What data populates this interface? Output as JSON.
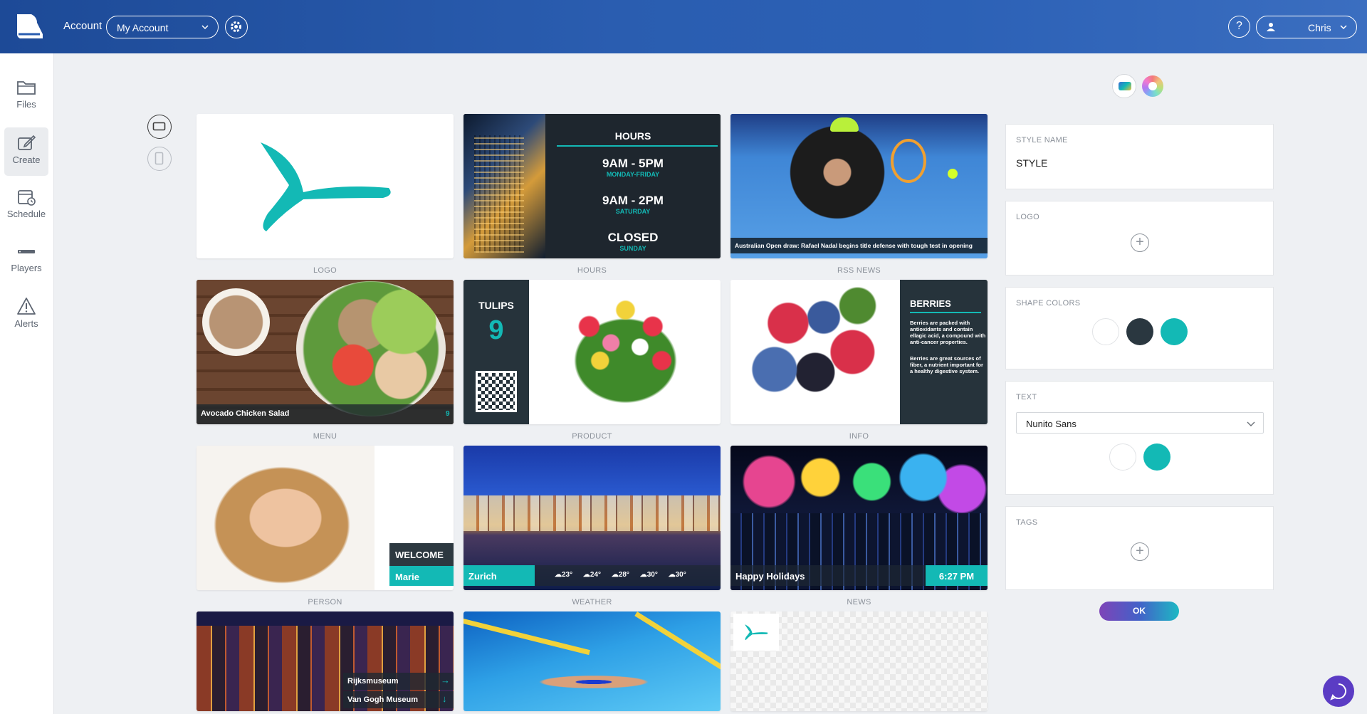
{
  "header": {
    "account_label": "Account",
    "account_select": "My Account",
    "help": "?",
    "user": "Chris"
  },
  "sidebar": {
    "items": [
      {
        "label": "Files",
        "icon": "folder-icon"
      },
      {
        "label": "Create",
        "icon": "edit-icon",
        "active": true
      },
      {
        "label": "Schedule",
        "icon": "calendar-icon"
      },
      {
        "label": "Players",
        "icon": "player-icon"
      },
      {
        "label": "Alerts",
        "icon": "alert-icon"
      }
    ]
  },
  "templates": [
    {
      "label": "LOGO"
    },
    {
      "label": "HOURS",
      "title": "HOURS",
      "rows": [
        {
          "time": "9AM - 5PM",
          "days": "MONDAY-FRIDAY"
        },
        {
          "time": "9AM - 2PM",
          "days": "SATURDAY"
        },
        {
          "time": "CLOSED",
          "days": "SUNDAY"
        }
      ]
    },
    {
      "label": "RSS NEWS",
      "caption": "Australian Open draw: Rafael Nadal begins title defense with tough test in opening"
    },
    {
      "label": "MENU",
      "caption": "Avocado Chicken Salad",
      "price": "9"
    },
    {
      "label": "PRODUCT",
      "title": "TULIPS",
      "price": "9"
    },
    {
      "label": "INFO",
      "title": "BERRIES",
      "text1": "Berries are packed with antioxidants and contain ellagic acid, a compound with anti-cancer properties.",
      "text2": "Berries are great sources of fiber, a nutrient important for a healthy digestive system."
    },
    {
      "label": "PERSON",
      "title": "WELCOME",
      "name": "Marie"
    },
    {
      "label": "WEATHER",
      "city": "Zurich",
      "temps": [
        "23°",
        "24°",
        "28°",
        "30°",
        "30°"
      ]
    },
    {
      "label": "NEWS",
      "caption": "Happy Holidays",
      "time": "6:27 PM"
    },
    {
      "label": "",
      "line1": "Rijksmuseum",
      "line2": "Van Gogh Museum"
    },
    {
      "label": ""
    },
    {
      "label": ""
    }
  ],
  "panel": {
    "style_name_label": "STYLE NAME",
    "style_name_value": "STYLE",
    "logo_label": "LOGO",
    "shape_colors_label": "SHAPE COLORS",
    "shape_colors": [
      "#ffffff",
      "#2a3740",
      "#13b9b5"
    ],
    "text_label": "TEXT",
    "font_value": "Nunito Sans",
    "text_colors": [
      "#ffffff",
      "#13b9b5"
    ],
    "tags_label": "TAGS",
    "ok": "OK"
  }
}
